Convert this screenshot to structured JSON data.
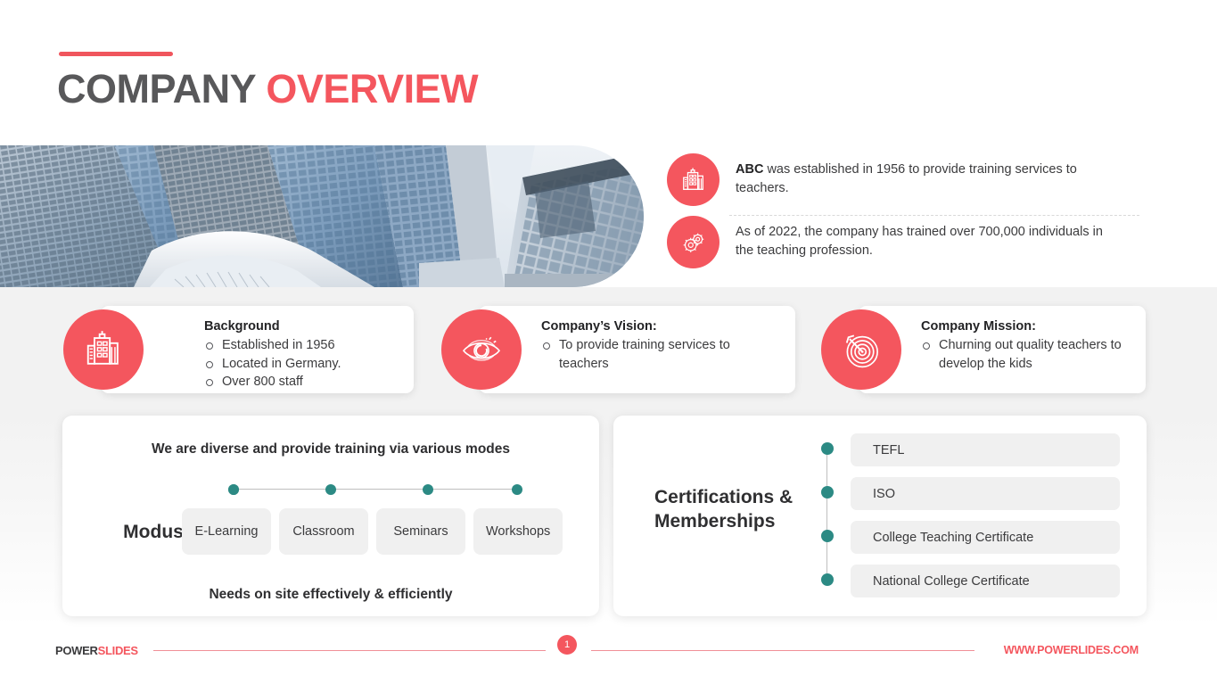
{
  "slide": {
    "title_main": "COMPANY",
    "title_accent": "OVERVIEW",
    "accent_color": "#f4565e",
    "teal_color": "#2c8a84",
    "hero_alt": "Low-angle photo of modern glass office skyscrapers"
  },
  "facts": [
    {
      "icon": "office-building-icon",
      "lead": "ABC",
      "text": " was established in 1956 to provide training services to teachers."
    },
    {
      "icon": "gears-icon",
      "lead": "",
      "text": "As of 2022, the company has trained over 700,000 individuals in the teaching profession."
    }
  ],
  "cards": [
    {
      "icon": "office-building-icon",
      "heading": "Background",
      "bullets": [
        "Established in 1956",
        "Located in Germany.",
        "Over 800 staff"
      ]
    },
    {
      "icon": "eye-vision-icon",
      "heading": "Company’s Vision:",
      "bullets": [
        "To provide training services to teachers"
      ]
    },
    {
      "icon": "target-dartboard-icon",
      "heading": "Company Mission:",
      "bullets": [
        "Churning out quality teachers to develop the kids"
      ]
    }
  ],
  "modus": {
    "headline": "We are diverse and provide training via various modes",
    "label": "Modus",
    "chips": [
      "E-Learning",
      "Classroom",
      "Seminars",
      "Workshops"
    ],
    "footline": "Needs on site effectively & efficiently"
  },
  "certifications": {
    "title": "Certifications & Memberships",
    "items": [
      "TEFL",
      "ISO",
      "College Teaching Certificate",
      "National College Certificate"
    ]
  },
  "footer": {
    "brand_main": "POWER",
    "brand_accent": "SLIDES",
    "page_number": "1",
    "site": "WWW.POWERLIDES.COM"
  }
}
